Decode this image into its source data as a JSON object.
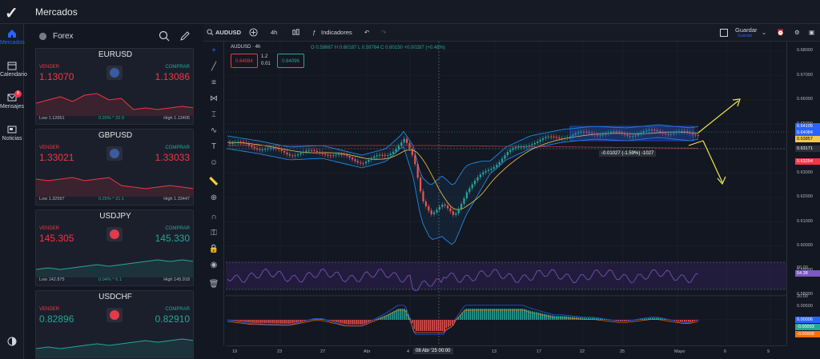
{
  "app": {
    "title": "Mercados",
    "logo": "check-logo"
  },
  "nav": [
    {
      "label": "Mercados",
      "icon": "home-icon",
      "active": true
    },
    {
      "label": "Calendario",
      "icon": "calendar-icon"
    },
    {
      "label": "Mensajes",
      "icon": "mail-icon",
      "badge": "8"
    },
    {
      "label": "Noticias",
      "icon": "news-icon"
    }
  ],
  "panel": {
    "section": "Forex",
    "icons": [
      "search-icon",
      "pencil-icon"
    ]
  },
  "quotes": [
    {
      "pair": "EURUSD",
      "sell_label": "VENDER",
      "buy_label": "COMPRAR",
      "sell": "1.13070",
      "buy": "1.13086",
      "low": "Low 1.12651",
      "high": "High 1.13405",
      "change": "0.20% ^ 22.9",
      "sell_color": "red",
      "buy_color": "red",
      "flag": "eu-us"
    },
    {
      "pair": "GBPUSD",
      "sell_label": "VENDER",
      "buy_label": "COMPRAR",
      "sell": "1.33021",
      "buy": "1.33033",
      "low": "Low 1.32597",
      "high": "High 1.33447",
      "change": "0.25% ^ 21.1",
      "sell_color": "red",
      "buy_color": "red",
      "flag": "gb-us"
    },
    {
      "pair": "USDJPY",
      "sell_label": "VENDER",
      "buy_label": "COMPRAR",
      "sell": "145.305",
      "buy": "145.330",
      "low": "Low 142.875",
      "high": "High 145.918",
      "change": "0.04% ^ 6.1",
      "sell_color": "red",
      "buy_color": "green",
      "flag": "us-jp"
    },
    {
      "pair": "USDCHF",
      "sell_label": "VENDER",
      "buy_label": "COMPRAR",
      "sell": "0.82896",
      "buy": "0.82910",
      "low": "",
      "high": "",
      "change": "",
      "sell_color": "green",
      "buy_color": "green",
      "flag": "us-ch"
    }
  ],
  "chart_toolbar": {
    "symbol": "AUDUSD",
    "interval": "4h",
    "indicators": "Indicadores",
    "save": "Guardar",
    "save_sub": "Guardar"
  },
  "legend": {
    "symbol_line": "AUDUSD · 4h",
    "ohlc": "O 0.59867  H 0.60187  L 0.59764  C 0.60150  +0.00287 (+0.48%)",
    "sell_box": "0.64084",
    "spread_top": "1.2",
    "spread_bottom": "0.01",
    "buy_box": "0.64096"
  },
  "measure_label": "-0.01027 (-1.59%) -1027",
  "crosshair_date": "08 Abr '25  00:00",
  "price_scale": {
    "labels": [
      "0.68000",
      "0.67000",
      "0.66000",
      "0.65000",
      "0.64000",
      "0.63000",
      "0.62000",
      "0.61000",
      "0.60000",
      "0.59000",
      "0.58000"
    ],
    "tags": [
      {
        "value": "0.64105",
        "color": "#2962ff"
      },
      {
        "value": "0.64084",
        "color": "#2962ff"
      },
      {
        "value": "0.63857",
        "color": "#f2c94c"
      },
      {
        "value": "0.63171",
        "color": "#2a2e39"
      },
      {
        "value": "0.63254",
        "color": "#f23645"
      }
    ],
    "rsi": [
      "60.00",
      "54.38",
      "20.00"
    ],
    "macd": [
      "0.00500",
      "0.00006",
      "-0.00003",
      "-0.00009"
    ]
  },
  "time_labels": [
    "19",
    "23",
    "27",
    "Abr",
    "4",
    "13",
    "17",
    "22",
    "25",
    "Mayo",
    "6",
    "9"
  ]
}
